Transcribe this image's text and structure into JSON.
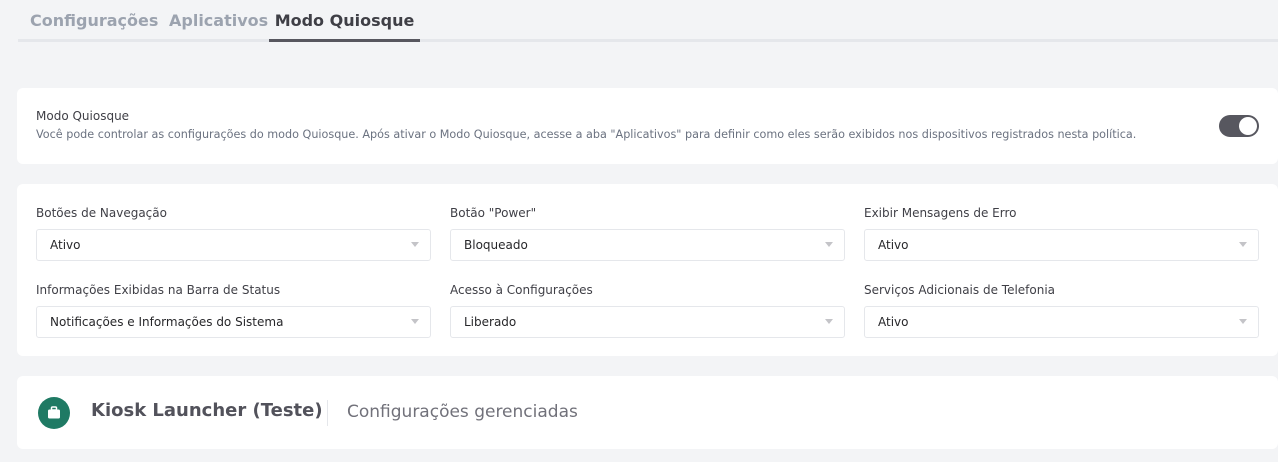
{
  "tabs": [
    {
      "label": "Configurações",
      "active": false
    },
    {
      "label": "Aplicativos",
      "active": false
    },
    {
      "label": "Modo Quiosque",
      "active": true
    }
  ],
  "kiosk": {
    "title": "Modo Quiosque",
    "description": "Você pode controlar as configurações do modo Quiosque. Após ativar o Modo Quiosque, acesse a aba \"Aplicativos\" para definir como eles serão exibidos nos dispositivos registrados nesta política.",
    "enabled": true
  },
  "options": [
    {
      "label": "Botões de Navegação",
      "value": "Ativo"
    },
    {
      "label": "Botão \"Power\"",
      "value": "Bloqueado"
    },
    {
      "label": "Exibir Mensagens de Erro",
      "value": "Ativo"
    },
    {
      "label": "Informações Exibidas na Barra de Status",
      "value": "Notificações e Informações do Sistema"
    },
    {
      "label": "Acesso à Configurações",
      "value": "Liberado"
    },
    {
      "label": "Serviços Adicionais de Telefonia",
      "value": "Ativo"
    }
  ],
  "launcher": {
    "icon": "briefcase-icon",
    "title": "Kiosk Launcher (Teste)",
    "subtitle": "Configurações gerenciadas"
  },
  "colors": {
    "background": "#f3f4f6",
    "toggle_on": "#57575f",
    "launcher_icon_bg": "#1f7a64",
    "active_tab_underline": "#57575f"
  }
}
